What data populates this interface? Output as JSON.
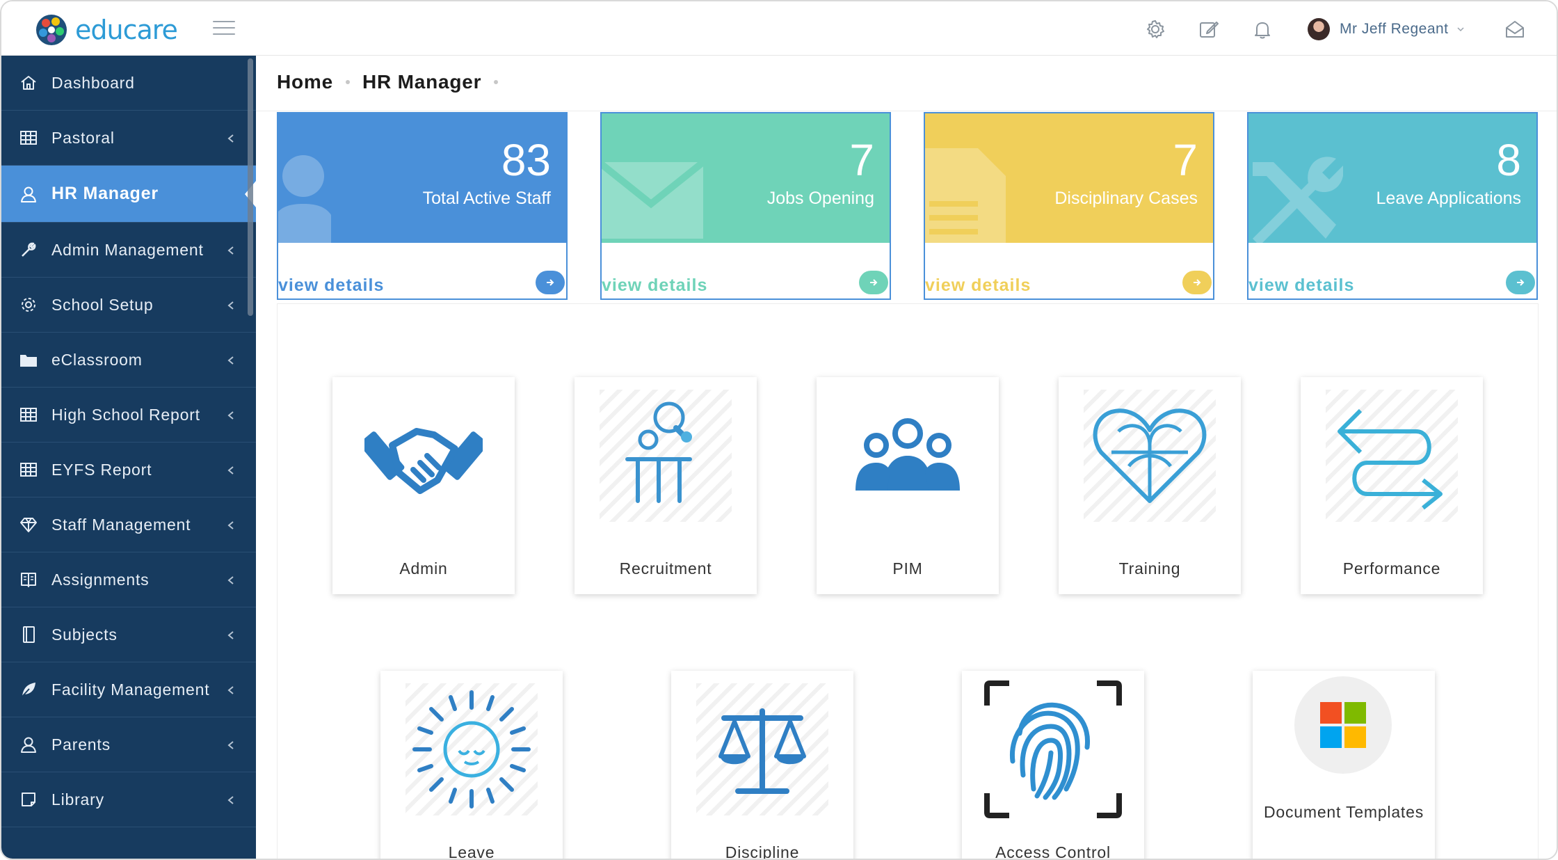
{
  "app": {
    "logo_text": "educare"
  },
  "header": {
    "user_name": "Mr Jeff Regeant",
    "icons": [
      "gear-icon",
      "edit-icon",
      "bell-icon",
      "mail-open-icon"
    ]
  },
  "sidebar": {
    "items": [
      {
        "label": "Dashboard",
        "icon": "home-icon"
      },
      {
        "label": "Pastoral",
        "icon": "table-icon"
      },
      {
        "label": "HR Manager",
        "icon": "user-icon",
        "active": true
      },
      {
        "label": "Admin Management",
        "icon": "wrench-icon"
      },
      {
        "label": "School Setup",
        "icon": "gear-icon"
      },
      {
        "label": "eClassroom",
        "icon": "folder-icon"
      },
      {
        "label": "High School Report",
        "icon": "table-icon"
      },
      {
        "label": "EYFS Report",
        "icon": "table-icon"
      },
      {
        "label": "Staff Management",
        "icon": "diamond-icon"
      },
      {
        "label": "Assignments",
        "icon": "book-icon"
      },
      {
        "label": "Subjects",
        "icon": "notebook-icon"
      },
      {
        "label": "Facility Management",
        "icon": "leaf-icon"
      },
      {
        "label": "Parents",
        "icon": "user-icon"
      },
      {
        "label": "Library",
        "icon": "note-icon"
      }
    ]
  },
  "breadcrumb": {
    "home": "Home",
    "current": "HR Manager"
  },
  "stats": [
    {
      "value": "83",
      "label": "Total Active Staff",
      "link": "view details",
      "color": "#4a90d9",
      "icon": "user-icon"
    },
    {
      "value": "7",
      "label": "Jobs Opening",
      "link": "view details",
      "color": "#6fd3b8",
      "icon": "envelope-icon"
    },
    {
      "value": "7",
      "label": "Disciplinary Cases",
      "link": "view details",
      "color": "#f0cf5a",
      "icon": "document-icon"
    },
    {
      "value": "8",
      "label": "Leave Applications",
      "link": "view details",
      "color": "#5bc0d0",
      "icon": "tools-icon"
    }
  ],
  "modules": [
    {
      "label": "Admin",
      "icon": "handshake-icon"
    },
    {
      "label": "Recruitment",
      "icon": "person-idea-icon"
    },
    {
      "label": "PIM",
      "icon": "group-icon"
    },
    {
      "label": "Training",
      "icon": "heart-icon"
    },
    {
      "label": "Performance",
      "icon": "arrows-loop-icon"
    },
    {
      "label": "Leave",
      "icon": "sun-icon"
    },
    {
      "label": "Discipline",
      "icon": "scales-icon"
    },
    {
      "label": "Access Control",
      "icon": "fingerprint-icon"
    },
    {
      "label": "Document Templates",
      "icon": "windows-logo-icon"
    }
  ]
}
